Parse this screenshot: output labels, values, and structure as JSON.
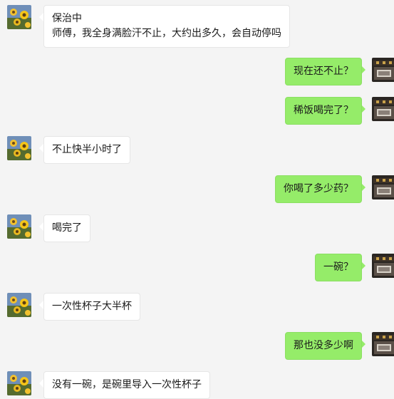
{
  "messages": [
    {
      "side": "left",
      "lines": [
        "保治中",
        "师傅，我全身满脸汗不止，大约出多久，会自动停吗"
      ]
    },
    {
      "side": "right",
      "text": "现在还不止？"
    },
    {
      "side": "right",
      "text": "稀饭喝完了？"
    },
    {
      "side": "left",
      "text": "不止快半小时了"
    },
    {
      "side": "right",
      "text": "你喝了多少药？"
    },
    {
      "side": "left",
      "text": "喝完了"
    },
    {
      "side": "right",
      "text": "一碗？"
    },
    {
      "side": "left",
      "text": "一次性杯子大半杯"
    },
    {
      "side": "right",
      "text": "那也没多少啊"
    },
    {
      "side": "left",
      "text": "没有一碗，是碗里导入一次性杯子"
    }
  ],
  "colors": {
    "background": "#f4f4f4",
    "left_bubble": "#ffffff",
    "right_bubble": "#95ec69"
  },
  "avatars": {
    "left": "sunflower-avatar",
    "right": "building-avatar"
  }
}
